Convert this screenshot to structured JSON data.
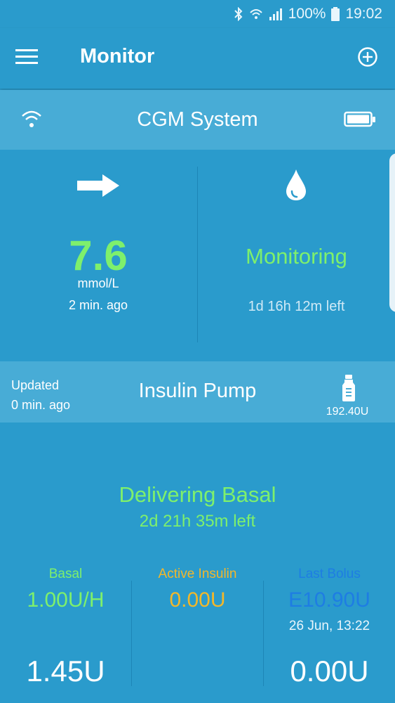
{
  "status_bar": {
    "battery_percent": "100%",
    "time": "19:02"
  },
  "app_bar": {
    "title": "Monitor",
    "menu_icon": "hamburger-menu-icon",
    "add_icon": "add-circle-icon"
  },
  "cgm": {
    "title": "CGM System",
    "glucose_value": "7.6",
    "glucose_unit": "mmol/L",
    "glucose_ago": "2 min. ago",
    "status": "Monitoring",
    "time_left": "1d 16h 12m left"
  },
  "pump": {
    "updated_label": "Updated",
    "updated_ago": "0 min. ago",
    "title": "Insulin Pump",
    "reservoir": "192.40U",
    "delivery_status": "Delivering Basal",
    "time_left": "2d 21h 35m left",
    "basal": {
      "label": "Basal",
      "rate": "1.00U/H",
      "total": "1.45U"
    },
    "active_insulin": {
      "label": "Active Insulin",
      "value": "0.00U"
    },
    "last_bolus": {
      "label": "Last Bolus",
      "value": "E10.90U",
      "date": "26 Jun, 13:22",
      "total": "0.00U"
    }
  },
  "colors": {
    "background": "#2a9bcc",
    "header_band": "#48acd6",
    "green": "#7ef06c",
    "orange": "#f3b72a",
    "blue": "#1e7de3"
  }
}
